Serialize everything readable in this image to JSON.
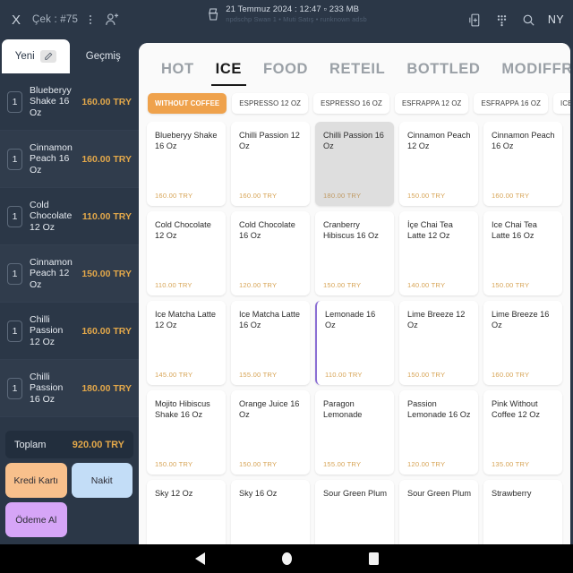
{
  "topbar": {
    "close_label": "X",
    "check_label": "Çek : #75",
    "menu_icon": "vertical-dots-icon",
    "add_user_icon": "add-user-icon",
    "printer_icon": "printer-icon",
    "datetime": "21 Temmuz 2024 : 12:47  ▫  233 MB",
    "subtitle": "npdschp Swan 1 • Muti Satış • runknown adsb",
    "add_device_icon": "add-device-icon",
    "grid_icon": "grid-dots-icon",
    "search_icon": "search-icon",
    "user_initials": "NY"
  },
  "sidebar": {
    "tabs": [
      {
        "label": "Yeni",
        "active": true,
        "icon": "pencil-icon"
      },
      {
        "label": "Geçmiş",
        "active": false
      }
    ],
    "orders": [
      {
        "qty": "1",
        "name": "Blueberyy Shake 16 Oz",
        "price": "160.00 TRY"
      },
      {
        "qty": "1",
        "name": "Cinnamon Peach 16 Oz",
        "price": "160.00 TRY"
      },
      {
        "qty": "1",
        "name": "Cold Chocolate 12 Oz",
        "price": "110.00 TRY"
      },
      {
        "qty": "1",
        "name": "Cinnamon Peach 12 Oz",
        "price": "150.00 TRY"
      },
      {
        "qty": "1",
        "name": "Chilli Passion 12 Oz",
        "price": "160.00 TRY"
      },
      {
        "qty": "1",
        "name": "Chilli Passion 16 Oz",
        "price": "180.00 TRY"
      }
    ],
    "total": {
      "label": "Toplam",
      "value": "920.00 TRY"
    },
    "payment": [
      {
        "label": "Kredi Kartı",
        "color": "#f8c08c"
      },
      {
        "label": "Nakit",
        "color": "#c3ddf7"
      },
      {
        "label": "Ödeme Al",
        "color": "#d6a5f7"
      }
    ]
  },
  "main": {
    "tabs": [
      {
        "label": "HOT",
        "active": false
      },
      {
        "label": "ICE",
        "active": true
      },
      {
        "label": "FOOD",
        "active": false
      },
      {
        "label": "RETEIL",
        "active": false
      },
      {
        "label": "BOTTLED",
        "active": false
      },
      {
        "label": "MODIFFRES",
        "active": false
      }
    ],
    "chips": [
      {
        "label": "WITHOUT COFFEE",
        "active": true
      },
      {
        "label": "ESPRESSO 12 OZ",
        "active": false
      },
      {
        "label": "ESPRESSO 16 OZ",
        "active": false
      },
      {
        "label": "ESFRAPPA 12 OZ",
        "active": false
      },
      {
        "label": "ESFRAPPA 16 OZ",
        "active": false
      },
      {
        "label": "ICE CREAM&MILKSHAKE",
        "active": false
      }
    ],
    "products": [
      {
        "name": "Blueberyy Shake 16 Oz",
        "price": "160.00 TRY",
        "selected": false,
        "accent": false
      },
      {
        "name": "Chilli Passion 12 Oz",
        "price": "160.00 TRY",
        "selected": false,
        "accent": false
      },
      {
        "name": "Chilli Passion 16 Oz",
        "price": "180.00 TRY",
        "selected": true,
        "accent": false
      },
      {
        "name": "Cinnamon Peach 12 Oz",
        "price": "150.00 TRY",
        "selected": false,
        "accent": false
      },
      {
        "name": "Cinnamon Peach 16 Oz",
        "price": "160.00 TRY",
        "selected": false,
        "accent": false
      },
      {
        "name": "Cold Chocolate 12 Oz",
        "price": "110.00 TRY",
        "selected": false,
        "accent": false
      },
      {
        "name": "Cold Chocolate 16 Oz",
        "price": "120.00 TRY",
        "selected": false,
        "accent": false
      },
      {
        "name": "Cranberry Hibiscus 16 Oz",
        "price": "150.00 TRY",
        "selected": false,
        "accent": false
      },
      {
        "name": "İçe Chai Tea Latte 12 Oz",
        "price": "140.00 TRY",
        "selected": false,
        "accent": false
      },
      {
        "name": "Ice Chai Tea Latte 16 Oz",
        "price": "150.00 TRY",
        "selected": false,
        "accent": false
      },
      {
        "name": "Ice Matcha Latte 12 Oz",
        "price": "145.00 TRY",
        "selected": false,
        "accent": false
      },
      {
        "name": "Ice Matcha Latte 16 Oz",
        "price": "155.00 TRY",
        "selected": false,
        "accent": false
      },
      {
        "name": "Lemonade 16 Oz",
        "price": "110.00 TRY",
        "selected": false,
        "accent": true
      },
      {
        "name": "Lime Breeze 12 Oz",
        "price": "150.00 TRY",
        "selected": false,
        "accent": false
      },
      {
        "name": "Lime Breeze 16 Oz",
        "price": "160.00 TRY",
        "selected": false,
        "accent": false
      },
      {
        "name": "Mojito Hibiscus Shake 16 Oz",
        "price": "150.00 TRY",
        "selected": false,
        "accent": false
      },
      {
        "name": "Orange Juice 16 Oz",
        "price": "150.00 TRY",
        "selected": false,
        "accent": false
      },
      {
        "name": "Paragon Lemonade",
        "price": "155.00 TRY",
        "selected": false,
        "accent": false
      },
      {
        "name": "Passion Lemonade 16 Oz",
        "price": "120.00 TRY",
        "selected": false,
        "accent": false
      },
      {
        "name": "Pink Without Coffee 12 Oz",
        "price": "135.00 TRY",
        "selected": false,
        "accent": false
      },
      {
        "name": "Sky 12 Oz",
        "price": "",
        "selected": false,
        "accent": false
      },
      {
        "name": "Sky 16 Oz",
        "price": "",
        "selected": false,
        "accent": false
      },
      {
        "name": "Sour Green Plum",
        "price": "",
        "selected": false,
        "accent": false
      },
      {
        "name": "Sour Green Plum",
        "price": "",
        "selected": false,
        "accent": false
      },
      {
        "name": "Strawberry",
        "price": "",
        "selected": false,
        "accent": false
      }
    ]
  },
  "navbar": {
    "back_icon": "back-triangle-icon",
    "home_icon": "home-circle-icon",
    "recents_icon": "recents-square-icon"
  }
}
